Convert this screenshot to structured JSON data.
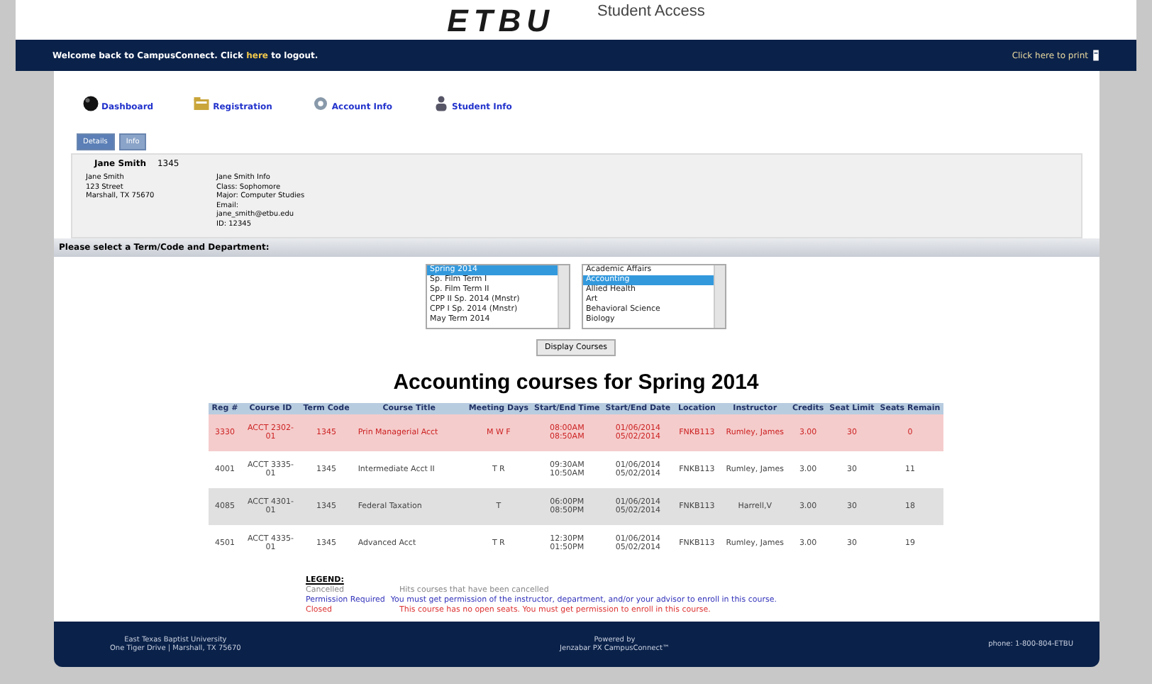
{
  "header": {
    "logo": "ETBU",
    "subtitle": "Student Access"
  },
  "top_bar": {
    "welcome": "Welcome back to CampusConnect. Click ",
    "link": "here",
    "after": " to logout.",
    "print": "Click here to print"
  },
  "nav": [
    {
      "label": "Dashboard"
    },
    {
      "label": "Registration"
    },
    {
      "label": "Account Info"
    },
    {
      "label": "Student Info"
    }
  ],
  "tabs": [
    {
      "label": "Details",
      "selected": true
    },
    {
      "label": "Info",
      "selected": false
    }
  ],
  "student": {
    "name_label": "Jane Smith",
    "term": "1345",
    "address": [
      "Jane Smith",
      "123 Street",
      "Marshall, TX 75670"
    ],
    "info": [
      "Jane Smith Info",
      "Class: Sophomore",
      "Major: Computer Studies",
      "Email: jane_smith@etbu.edu",
      "ID: 12345"
    ]
  },
  "section_title": "Please select a Term/Code and Department:",
  "terms": [
    {
      "label": "Spring 2014",
      "selected": true
    },
    {
      "label": "Sp. Film Term I",
      "selected": false
    },
    {
      "label": "Sp. Film Term II",
      "selected": false
    },
    {
      "label": "CPP II Sp. 2014 (Mnstr)",
      "selected": false
    },
    {
      "label": "CPP I Sp. 2014 (Mnstr)",
      "selected": false
    },
    {
      "label": "May Term 2014",
      "selected": false
    }
  ],
  "departments": [
    {
      "label": "Academic Affairs",
      "selected": false
    },
    {
      "label": "Accounting",
      "selected": true
    },
    {
      "label": "Allied Health",
      "selected": false
    },
    {
      "label": "Art",
      "selected": false
    },
    {
      "label": "Behavioral Science",
      "selected": false
    },
    {
      "label": "Biology",
      "selected": false
    }
  ],
  "display_button": "Display Courses",
  "results_title": "Accounting courses for Spring 2014",
  "table": {
    "columns": [
      "Reg #",
      "Course ID",
      "Term Code",
      "Course Title",
      "Meeting Days",
      "Start/End Time",
      "Start/End Date",
      "Location",
      "Instructor",
      "Credits",
      "Seat Limit",
      "Seats Remain"
    ],
    "rows": [
      {
        "closed": true,
        "cells": [
          "3330",
          "ACCT 2302-01",
          "1345",
          "Prin Managerial Acct",
          "M W F",
          "08:00AM 08:50AM",
          "01/06/2014 05/02/2014",
          "FNKB113",
          "Rumley, James",
          "3.00",
          "30",
          "0"
        ]
      },
      {
        "closed": false,
        "cells": [
          "4001",
          "ACCT 3335-01",
          "1345",
          "Intermediate Acct II",
          "T R",
          "09:30AM 10:50AM",
          "01/06/2014 05/02/2014",
          "FNKB113",
          "Rumley, James",
          "3.00",
          "30",
          "11"
        ]
      },
      {
        "closed": false,
        "cells": [
          "4085",
          "ACCT 4301-01",
          "1345",
          "Federal Taxation",
          "T",
          "06:00PM 08:50PM",
          "01/06/2014 05/02/2014",
          "FNKB113",
          "Harrell,V",
          "3.00",
          "30",
          "18"
        ]
      },
      {
        "closed": false,
        "cells": [
          "4501",
          "ACCT 4335-01",
          "1345",
          "Advanced Acct",
          "T R",
          "12:30PM 01:50PM",
          "01/06/2014 05/02/2014",
          "FNKB113",
          "Rumley, James",
          "3.00",
          "30",
          "19"
        ]
      }
    ]
  },
  "legend": {
    "title": "LEGEND:",
    "items": [
      {
        "kind": "cancelled",
        "label": "Cancelled",
        "text": "Hits courses that have been cancelled"
      },
      {
        "kind": "permission",
        "label": "Permission Required",
        "text": "You must get permission of the instructor, department, and/or your advisor to enroll in this course."
      },
      {
        "kind": "closed",
        "label": "Closed",
        "text": "This course has no open seats. You must get permission to enroll in this course."
      }
    ]
  },
  "footer": {
    "left": [
      "East Texas Baptist University",
      "One Tiger Drive | Marshall, TX 75670"
    ],
    "center": [
      "Powered by",
      "Jenzabar PX CampusConnect™"
    ],
    "right": "phone: 1-800-804-ETBU"
  }
}
